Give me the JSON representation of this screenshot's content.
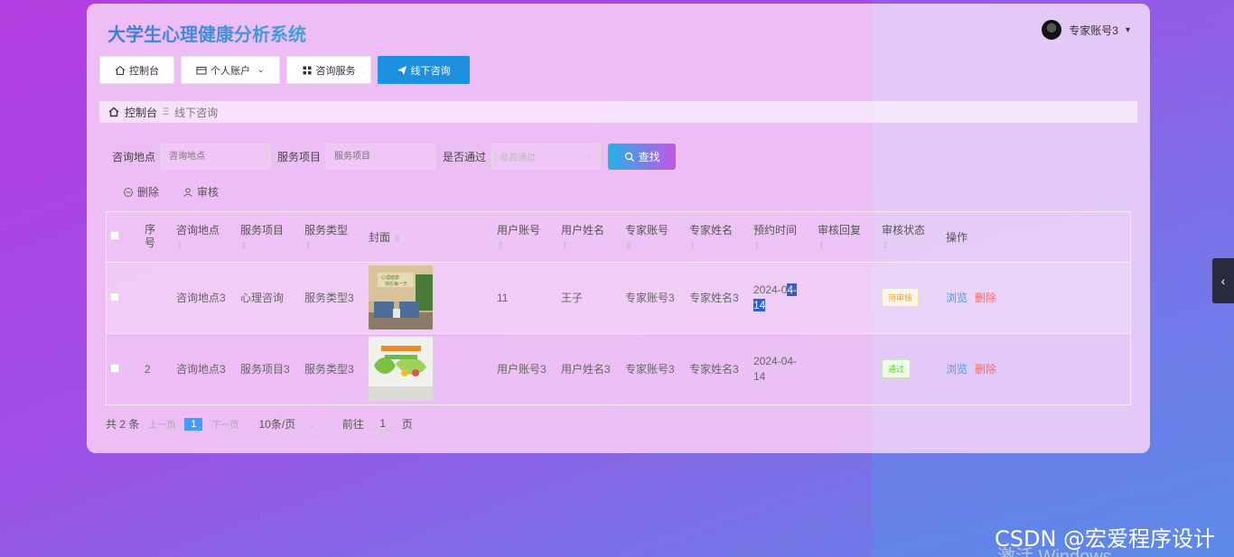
{
  "app": {
    "title": "大学生心理健康分析系统"
  },
  "user": {
    "name": "专家账号3",
    "caret": "▾"
  },
  "nav": [
    {
      "label": "控制台",
      "icon": "home-icon"
    },
    {
      "label": "个人账户",
      "icon": "wallet-icon",
      "has_dropdown": true
    },
    {
      "label": "咨询服务",
      "icon": "grid-icon"
    },
    {
      "label": "线下咨询",
      "icon": "send-icon",
      "active": true
    }
  ],
  "breadcrumb": {
    "home": "控制台",
    "sep": "Ξ",
    "current": "线下咨询"
  },
  "search": {
    "location_label": "咨询地点",
    "location_placeholder": "咨询地点",
    "service_label": "服务项目",
    "service_placeholder": "服务项目",
    "pass_label": "是否通过",
    "pass_placeholder": "是否通过",
    "button": "查找"
  },
  "actions": {
    "delete": "删除",
    "review": "审核"
  },
  "table": {
    "headers": [
      "序号",
      "咨询地点",
      "服务项目",
      "服务类型",
      "封面",
      "用户账号",
      "用户姓名",
      "专家账号",
      "专家姓名",
      "预约时间",
      "审核回复",
      "审核状态",
      "操作"
    ],
    "rows": [
      {
        "index": "",
        "location": "咨询地点3",
        "service": "心理咨询",
        "type": "服务类型3",
        "account": "11",
        "username": "王子",
        "expert_account": "专家账号3",
        "expert_name": "专家姓名3",
        "time_a": "2024-0",
        "time_b": "4-",
        "time_c": "14",
        "reply": "",
        "status": "待审核",
        "view": "浏览",
        "delete": "删除"
      },
      {
        "index": "2",
        "location": "咨询地点3",
        "service": "服务项目3",
        "type": "服务类型3",
        "account": "用户账号3",
        "username": "用户姓名3",
        "expert_account": "专家账号3",
        "expert_name": "专家姓名3",
        "time_a": "2024-04-",
        "time_b": "",
        "time_c": "14",
        "reply": "",
        "status": "通过",
        "view": "浏览",
        "delete": "删除"
      }
    ]
  },
  "pagination": {
    "total": "共 2 条",
    "prev": "上一页",
    "page": "1",
    "next": "下一页",
    "size": "10条/页",
    "goto_label": "前往",
    "goto_value": "1",
    "goto_suffix": "页"
  },
  "watermark": "CSDN @宏爱程序设计",
  "windows_watermark": "激活 Windows",
  "colors": {
    "accent": "#1e90e0",
    "pending": "#e6a23c",
    "pass": "#67c23a",
    "link": "#409eff",
    "danger": "#f56c6c"
  }
}
